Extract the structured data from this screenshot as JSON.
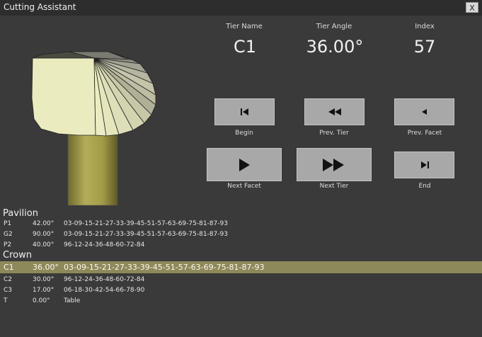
{
  "window": {
    "title": "Cutting Assistant",
    "close_label": "X"
  },
  "info": {
    "tier_name_label": "Tier Name",
    "tier_angle_label": "Tier Angle",
    "index_label": "Index",
    "tier_name": "C1",
    "tier_angle": "36.00°",
    "index": "57"
  },
  "nav": {
    "begin": "Begin",
    "prev_tier": "Prev. Tier",
    "prev_facet": "Prev. Facet",
    "next_facet": "Next Facet",
    "next_tier": "Next Tier",
    "end": "End"
  },
  "sections": {
    "pavilion": "Pavilion",
    "crown": "Crown"
  },
  "pavilion_rows": [
    {
      "name": "P1",
      "angle": "42.00°",
      "indexes": "03-09-15-21-27-33-39-45-51-57-63-69-75-81-87-93"
    },
    {
      "name": "G2",
      "angle": "90.00°",
      "indexes": "03-09-15-21-27-33-39-45-51-57-63-69-75-81-87-93"
    },
    {
      "name": "P2",
      "angle": "40.00°",
      "indexes": "96-12-24-36-48-60-72-84"
    }
  ],
  "crown_rows": [
    {
      "name": "C1",
      "angle": "36.00°",
      "indexes": "03-09-15-21-27-33-39-45-51-57-63-69-75-81-87-93"
    },
    {
      "name": "C2",
      "angle": "30.00°",
      "indexes": "96-12-24-36-48-60-72-84"
    },
    {
      "name": "C3",
      "angle": "17.00°",
      "indexes": "06-18-30-42-54-66-78-90"
    },
    {
      "name": "T",
      "angle": "0.00°",
      "indexes": "Table"
    }
  ],
  "colors": {
    "background": "#3a3a3a",
    "selected_row": "#8e895a",
    "dop": "#a09a4a",
    "stone_face": "#ebebc0"
  }
}
